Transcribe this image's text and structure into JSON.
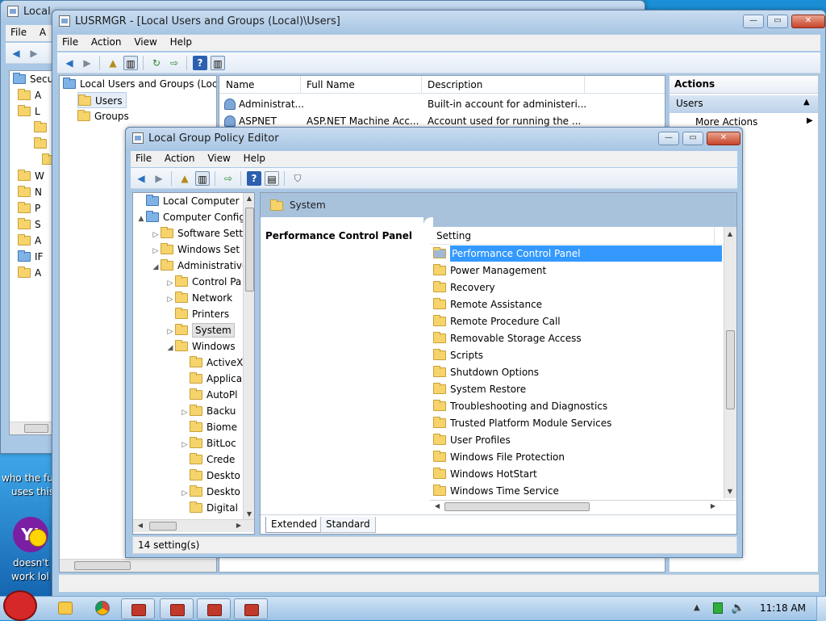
{
  "colors": {
    "selection": "#3399ff",
    "desktop": "#1a8fd6",
    "window_frame": "#a9c8e6"
  },
  "background_window": {
    "title": "Local",
    "menu": [
      "File",
      "A"
    ],
    "tree_items": [
      "Secu",
      "A",
      "L",
      "W",
      "N",
      "P",
      "S",
      "A",
      "IF",
      "A"
    ]
  },
  "lusrmgr": {
    "title": "LUSRMGR - [Local Users and Groups (Local)\\Users]",
    "menu": [
      "File",
      "Action",
      "View",
      "Help"
    ],
    "tree": {
      "root": "Local Users and Groups (Loca",
      "items": [
        "Users",
        "Groups"
      ]
    },
    "columns": [
      "Name",
      "Full Name",
      "Description"
    ],
    "rows": [
      {
        "name": "Administrat...",
        "full_name": "",
        "description": "Built-in account for administeri..."
      },
      {
        "name": "ASPNET",
        "full_name": "ASP.NET Machine Acc...",
        "description": "Account used for running the ..."
      }
    ],
    "actions": {
      "header": "Actions",
      "section": "Users",
      "more": "More Actions"
    }
  },
  "gpedit": {
    "title": "Local Group Policy Editor",
    "menu": [
      "File",
      "Action",
      "View",
      "Help"
    ],
    "tree": [
      {
        "label": "Local Computer Poli",
        "level": 0,
        "arrow": "",
        "icon": "computer"
      },
      {
        "label": "Computer Config",
        "level": 0,
        "arrow": "▲",
        "icon": "computer"
      },
      {
        "label": "Software Sett",
        "level": 1,
        "arrow": "▷",
        "icon": "folder"
      },
      {
        "label": "Windows Set",
        "level": 1,
        "arrow": "▷",
        "icon": "folder"
      },
      {
        "label": "Administrative",
        "level": 1,
        "arrow": "◢",
        "icon": "folder"
      },
      {
        "label": "Control Pa",
        "level": 2,
        "arrow": "▷",
        "icon": "folder"
      },
      {
        "label": "Network",
        "level": 2,
        "arrow": "▷",
        "icon": "folder"
      },
      {
        "label": "Printers",
        "level": 2,
        "arrow": "",
        "icon": "folder"
      },
      {
        "label": "System",
        "level": 2,
        "arrow": "▷",
        "icon": "folder",
        "selected": true
      },
      {
        "label": "Windows",
        "level": 2,
        "arrow": "◢",
        "icon": "folder"
      },
      {
        "label": "ActiveX",
        "level": 3,
        "arrow": "",
        "icon": "folder"
      },
      {
        "label": "Applica",
        "level": 3,
        "arrow": "",
        "icon": "folder"
      },
      {
        "label": "AutoPl",
        "level": 3,
        "arrow": "",
        "icon": "folder"
      },
      {
        "label": "Backu",
        "level": 3,
        "arrow": "▷",
        "icon": "folder"
      },
      {
        "label": "Biome",
        "level": 3,
        "arrow": "",
        "icon": "folder"
      },
      {
        "label": "BitLoc",
        "level": 3,
        "arrow": "▷",
        "icon": "folder"
      },
      {
        "label": "Crede",
        "level": 3,
        "arrow": "",
        "icon": "folder"
      },
      {
        "label": "Deskto",
        "level": 3,
        "arrow": "",
        "icon": "folder"
      },
      {
        "label": "Deskto",
        "level": 3,
        "arrow": "▷",
        "icon": "folder"
      },
      {
        "label": "Digital",
        "level": 3,
        "arrow": "",
        "icon": "folder"
      }
    ],
    "header_title": "System",
    "description_title": "Performance Control Panel",
    "settings_header": "Setting",
    "settings": [
      "Performance Control Panel",
      "Power Management",
      "Recovery",
      "Remote Assistance",
      "Remote Procedure Call",
      "Removable Storage Access",
      "Scripts",
      "Shutdown Options",
      "System Restore",
      "Troubleshooting and Diagnostics",
      "Trusted Platform Module Services",
      "User Profiles",
      "Windows File Protection",
      "Windows HotStart",
      "Windows Time Service"
    ],
    "selected_setting": 0,
    "tabs": [
      "Extended",
      "Standard"
    ],
    "status": "14 setting(s)"
  },
  "desktop": {
    "text1": "who the fu",
    "text2": "uses this",
    "text3": "doesn't",
    "text4": "work lol",
    "yahoo": "Y!"
  },
  "taskbar": {
    "time": "11:18 AM"
  }
}
